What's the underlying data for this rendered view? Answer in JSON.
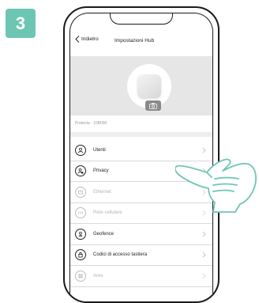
{
  "step": {
    "number": "3",
    "color": "#6dc6b4"
  },
  "header": {
    "back_label": "Indietro",
    "title": "Impostazioni Hub"
  },
  "hub": {
    "name": "Protecta - 10B000"
  },
  "menu": {
    "items": [
      {
        "label": "Utenti",
        "icon": "users-icon",
        "enabled": true
      },
      {
        "label": "Privacy",
        "icon": "privacy-icon",
        "enabled": true
      },
      {
        "label": "Ethernet",
        "icon": "ethernet-icon",
        "enabled": false
      },
      {
        "label": "Rete cellulare",
        "icon": "cellular-icon",
        "enabled": false
      },
      {
        "label": "Geofence",
        "icon": "geofence-icon",
        "enabled": true
      },
      {
        "label": "Codici di accesso tastiera",
        "icon": "keypad-lock-icon",
        "enabled": true
      },
      {
        "label": "Aree",
        "icon": "areas-icon",
        "enabled": false
      }
    ]
  },
  "colors": {
    "hand_stroke": "#6dc6b4",
    "accent": "#6dc6b4"
  }
}
